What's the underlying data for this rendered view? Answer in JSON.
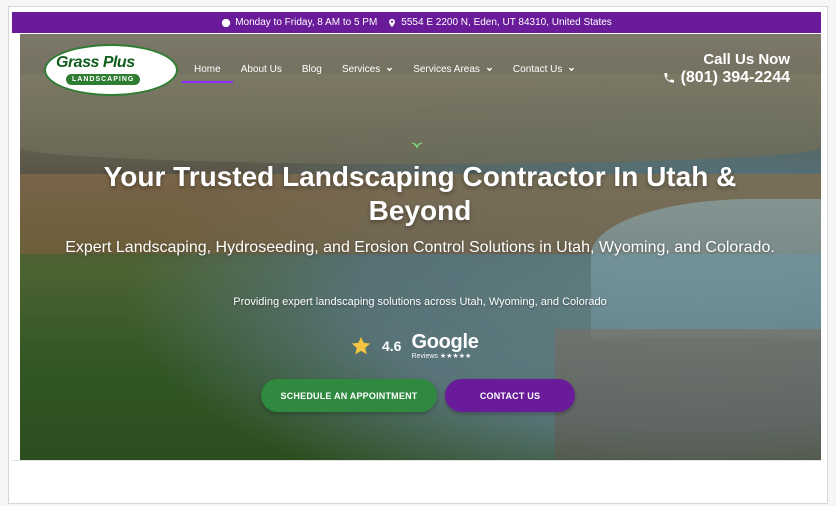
{
  "top_bar": {
    "hours": "Monday to Friday, 8 AM to 5 PM",
    "address": "5554 E 2200 N, Eden, UT 84310, United States",
    "background_color": "#6a1b9a"
  },
  "brand": {
    "name": "Grass Plus",
    "tagline": "LANDSCAPING",
    "logo_color": "#2f7d32"
  },
  "nav": {
    "items": [
      {
        "label": "Home",
        "has_dropdown": false,
        "active": true
      },
      {
        "label": "About Us",
        "has_dropdown": false,
        "active": false
      },
      {
        "label": "Blog",
        "has_dropdown": false,
        "active": false
      },
      {
        "label": "Services",
        "has_dropdown": true,
        "active": false
      },
      {
        "label": "Services Areas",
        "has_dropdown": true,
        "active": false
      },
      {
        "label": "Contact Us",
        "has_dropdown": true,
        "active": false
      }
    ],
    "active_underline_color": "#8e2cff"
  },
  "call": {
    "label": "Call Us Now",
    "phone": "(801) 394-2244"
  },
  "hero": {
    "headline": "Your Trusted Landscaping Contractor In Utah & Beyond",
    "subheadline": "Expert Landscaping, Hydroseeding, and Erosion Control Solutions in Utah, Wyoming, and Colorado.",
    "note": "Providing expert landscaping solutions across Utah, Wyoming, and Colorado",
    "rating": {
      "score": "4.6",
      "provider": "Google",
      "provider_sub": "Reviews ★★★★★",
      "star_color": "#f5c542"
    },
    "buttons": {
      "schedule": "SCHEDULE AN APPOINTMENT",
      "contact": "CONTACT US",
      "schedule_color": "#2f8a3f",
      "contact_color": "#6a1b9a"
    }
  }
}
